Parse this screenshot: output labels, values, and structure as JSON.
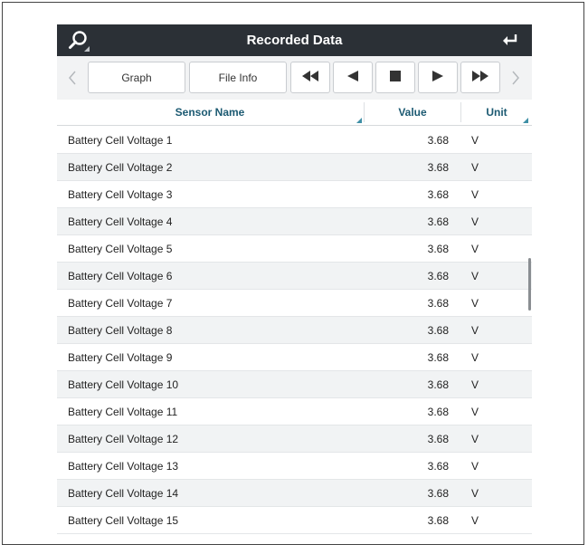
{
  "window": {
    "title": "Recorded Data"
  },
  "toolbar": {
    "graph_label": "Graph",
    "file_info_label": "File Info"
  },
  "table": {
    "columns": {
      "sensor_name": "Sensor Name",
      "value": "Value",
      "unit": "Unit"
    },
    "rows": [
      {
        "name": "Battery Cell Voltage 1",
        "value": "3.68",
        "unit": "V"
      },
      {
        "name": "Battery Cell Voltage 2",
        "value": "3.68",
        "unit": "V"
      },
      {
        "name": "Battery Cell Voltage 3",
        "value": "3.68",
        "unit": "V"
      },
      {
        "name": "Battery Cell Voltage 4",
        "value": "3.68",
        "unit": "V"
      },
      {
        "name": "Battery Cell Voltage 5",
        "value": "3.68",
        "unit": "V"
      },
      {
        "name": "Battery Cell Voltage 6",
        "value": "3.68",
        "unit": "V"
      },
      {
        "name": "Battery Cell Voltage 7",
        "value": "3.68",
        "unit": "V"
      },
      {
        "name": "Battery Cell Voltage 8",
        "value": "3.68",
        "unit": "V"
      },
      {
        "name": "Battery Cell Voltage 9",
        "value": "3.68",
        "unit": "V"
      },
      {
        "name": "Battery Cell Voltage 10",
        "value": "3.68",
        "unit": "V"
      },
      {
        "name": "Battery Cell Voltage 11",
        "value": "3.68",
        "unit": "V"
      },
      {
        "name": "Battery Cell Voltage 12",
        "value": "3.68",
        "unit": "V"
      },
      {
        "name": "Battery Cell Voltage 13",
        "value": "3.68",
        "unit": "V"
      },
      {
        "name": "Battery Cell Voltage 14",
        "value": "3.68",
        "unit": "V"
      },
      {
        "name": "Battery Cell Voltage 15",
        "value": "3.68",
        "unit": "V"
      }
    ]
  },
  "icons": {
    "search": "search-icon",
    "back": "return-arrow-icon",
    "scroll_left": "chevron-left-icon",
    "scroll_right": "chevron-right-icon",
    "rewind": "rewind-icon",
    "step_back": "step-back-icon",
    "stop": "stop-icon",
    "play": "play-icon",
    "fast_forward": "fast-forward-icon"
  },
  "colors": {
    "titlebar": "#2b3036",
    "header_text": "#1c5a72",
    "sort_marker": "#3f8fa6",
    "row_alt": "#f1f3f4"
  }
}
